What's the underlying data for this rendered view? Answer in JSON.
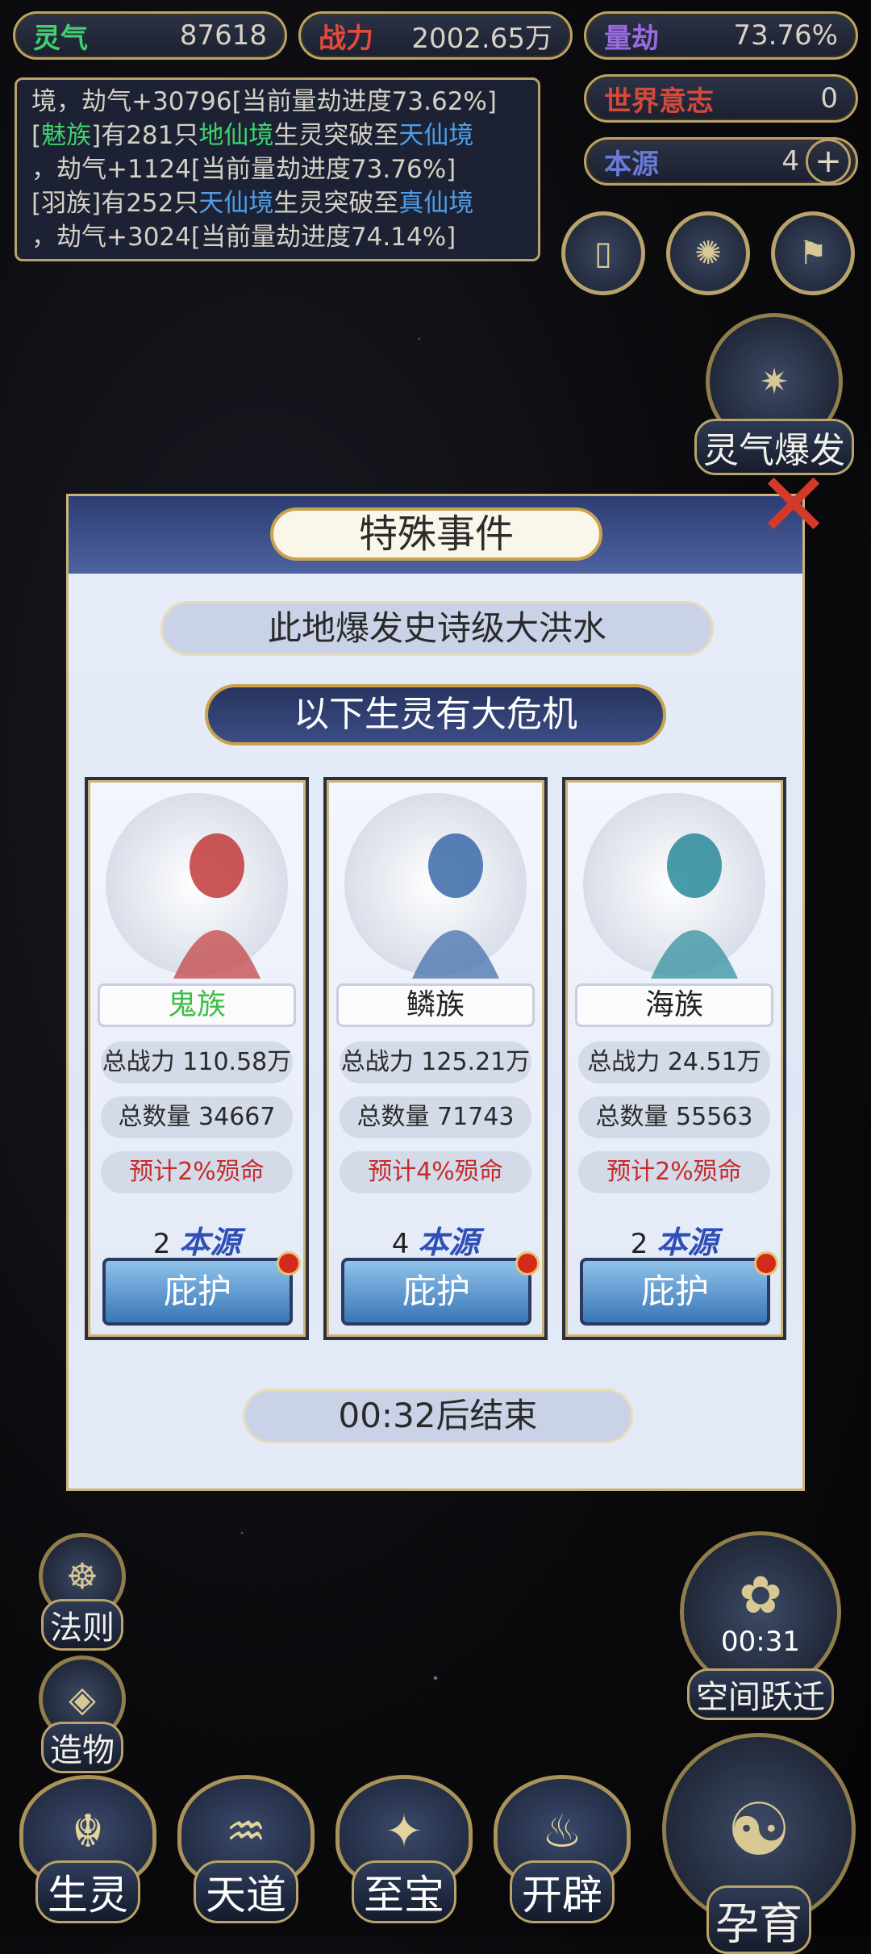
{
  "stats": {
    "lingqi": {
      "label": "灵气",
      "value": "87618"
    },
    "zhanli": {
      "label": "战力",
      "value": "2002.65万"
    },
    "liangjie": {
      "label": "量劫",
      "value": "73.76%"
    },
    "shijie": {
      "label": "世界意志",
      "value": "0"
    },
    "benyuan": {
      "label": "本源",
      "value": "4"
    }
  },
  "log": [
    {
      "parts": [
        {
          "t": "境，劫气+30796[当前量劫进度73.62%]",
          "c": ""
        }
      ]
    },
    {
      "parts": [
        {
          "t": "[",
          "c": ""
        },
        {
          "t": "魅族",
          "c": "g"
        },
        {
          "t": "]有281只",
          "c": ""
        },
        {
          "t": "地仙境",
          "c": "g"
        },
        {
          "t": "生灵突破至",
          "c": ""
        },
        {
          "t": "天仙境",
          "c": "b"
        }
      ]
    },
    {
      "parts": [
        {
          "t": "，劫气+1124[当前量劫进度73.76%]",
          "c": ""
        }
      ]
    },
    {
      "parts": [
        {
          "t": "[羽族]有252只",
          "c": ""
        },
        {
          "t": "天仙境",
          "c": "b"
        },
        {
          "t": "生灵突破至",
          "c": ""
        },
        {
          "t": "真仙境",
          "c": "b"
        }
      ]
    },
    {
      "parts": [
        {
          "t": "，劫气+3024[当前量劫进度74.14%]",
          "c": ""
        }
      ]
    }
  ],
  "side_labels": {
    "lingqi_burst": "灵气爆发",
    "fa_ze": "法则",
    "zao_wu": "造物",
    "space_jump": "空间跃迁",
    "space_timer": "00:31",
    "yun_yu": "孕育"
  },
  "bottom_nav": [
    "生灵",
    "天道",
    "至宝",
    "开辟"
  ],
  "modal": {
    "title": "特殊事件",
    "event": "此地爆发史诗级大洪水",
    "banner": "以下生灵有大危机",
    "timer": "00:32后结束",
    "cards": [
      {
        "name": "鬼族",
        "name_color": "#3fbf45",
        "power": "总战力 110.58万",
        "count": "总数量 34667",
        "risk": "预计2%殒命",
        "cost_num": "2",
        "cost_unit": "本源",
        "button": "庇护"
      },
      {
        "name": "鳞族",
        "name_color": "#222222",
        "power": "总战力 125.21万",
        "count": "总数量 71743",
        "risk": "预计4%殒命",
        "cost_num": "4",
        "cost_unit": "本源",
        "button": "庇护"
      },
      {
        "name": "海族",
        "name_color": "#222222",
        "power": "总战力 24.51万",
        "count": "总数量 55563",
        "risk": "预计2%殒命",
        "cost_num": "2",
        "cost_unit": "本源",
        "button": "庇护"
      }
    ]
  }
}
